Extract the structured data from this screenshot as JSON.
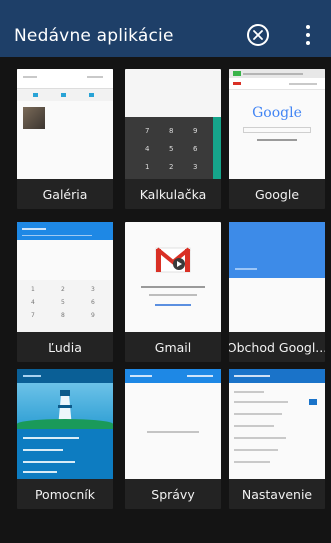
{
  "header": {
    "title": "Nedávne aplikácie"
  },
  "apps": [
    {
      "label": "Galéria"
    },
    {
      "label": "Kalkulačka"
    },
    {
      "label": "Google"
    },
    {
      "label": "Ľudia"
    },
    {
      "label": "Gmail"
    },
    {
      "label": "Obchod Googl..."
    },
    {
      "label": "Pomocník"
    },
    {
      "label": "Správy"
    },
    {
      "label": "Nastavenie"
    }
  ],
  "thumbs": {
    "google_logo": "Google",
    "calc_digits": [
      "7",
      "8",
      "9",
      "4",
      "5",
      "6",
      "1",
      "2",
      "3"
    ],
    "people_keys": [
      "1",
      "2",
      "3",
      "4",
      "5",
      "6",
      "7",
      "8",
      "9"
    ]
  },
  "colors": {
    "header_bg": "#1e3f68",
    "background": "#141414",
    "card_bg": "#232323",
    "people_blue": "#1e88e5",
    "gmail_red": "#d93025",
    "store_blue": "#3d8be8",
    "help_blue": "#0d7cc1",
    "settings_blue": "#1a73c9"
  }
}
